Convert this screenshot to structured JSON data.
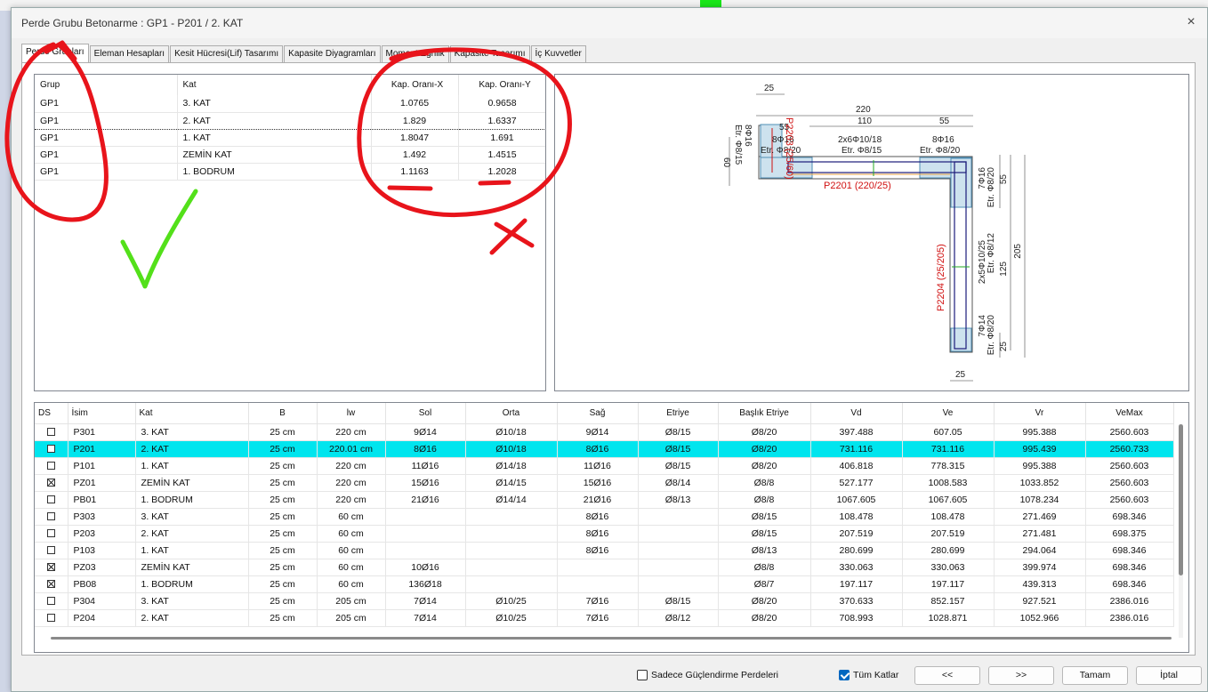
{
  "window": {
    "title": "Perde Grubu Betonarme : GP1 - P201 / 2. KAT",
    "close_icon": "×"
  },
  "tabs": [
    {
      "label": "Perde Grupları",
      "active": true
    },
    {
      "label": "Eleman Hesapları"
    },
    {
      "label": "Kesit Hücresi(Lif) Tasarımı"
    },
    {
      "label": "Kapasite Diyagramları"
    },
    {
      "label": "Moment Eğrilik"
    },
    {
      "label": "Kapasite Tasarımı"
    },
    {
      "label": "İç Kuvvetler"
    }
  ],
  "group_table": {
    "columns": [
      "Grup",
      "Kat",
      "Kap. Oranı-X",
      "Kap. Oranı-Y"
    ],
    "rows": [
      [
        "GP1",
        "3. KAT",
        "1.0765",
        "0.9658"
      ],
      [
        "GP1",
        "2. KAT",
        "1.829",
        "1.6337"
      ],
      [
        "GP1",
        "1. KAT",
        "1.8047",
        "1.691"
      ],
      [
        "GP1",
        "ZEMİN KAT",
        "1.492",
        "1.4515"
      ],
      [
        "GP1",
        "1. BODRUM",
        "1.1163",
        "1.2028"
      ]
    ],
    "selected_row": 1
  },
  "section_drawing": {
    "dims": {
      "top_25": "25",
      "total_220": "220",
      "mid_110": "110",
      "right_55": "55",
      "left_55": "55",
      "left_60": "60",
      "right_v_55": "55",
      "right_v_125": "125",
      "right_v_205": "205",
      "right_v_25": "25",
      "bottom_25": "25"
    },
    "labels": {
      "p2203": "P2203 (25/60)",
      "left_reb": "8Φ16",
      "left_etr": "Etr. Φ8/15",
      "c1_reb": "8Φ16",
      "c1_etr": "Etr. Φ8/20",
      "web_reb": "2x6Φ10/18",
      "web_etr": "Etr. Φ8/15",
      "c2_reb": "8Φ16",
      "c2_etr": "Etr. Φ8/20",
      "p2201": "P2201 (220/25)",
      "c3_reb": "7Φ16",
      "c3_etr": "Etr. Φ8/20",
      "web2_reb": "2x5Φ10/25",
      "web2_etr": "Etr. Φ8/12",
      "p2204": "P2204 (25/205)",
      "c4_reb": "7Φ14",
      "c4_etr": "Etr. Φ8/20"
    }
  },
  "element_table": {
    "columns": [
      "DS",
      "İsim",
      "Kat",
      "B",
      "lw",
      "Sol",
      "Orta",
      "Sağ",
      "Etriye",
      "Başlık Etriye",
      "Vd",
      "Ve",
      "Vr",
      "VeMax"
    ],
    "rows": [
      {
        "ds": false,
        "cells": [
          "P301",
          "3. KAT",
          "25 cm",
          "220 cm",
          "9Ø14",
          "Ø10/18",
          "9Ø14",
          "Ø8/15",
          "Ø8/20",
          "397.488",
          "607.05",
          "995.388",
          "2560.603"
        ]
      },
      {
        "ds": false,
        "cells": [
          "P201",
          "2. KAT",
          "25 cm",
          "220.01 cm",
          "8Ø16",
          "Ø10/18",
          "8Ø16",
          "Ø8/15",
          "Ø8/20",
          "731.116",
          "731.116",
          "995.439",
          "2560.733"
        ],
        "highlight": true
      },
      {
        "ds": false,
        "cells": [
          "P101",
          "1. KAT",
          "25 cm",
          "220 cm",
          "11Ø16",
          "Ø14/18",
          "11Ø16",
          "Ø8/15",
          "Ø8/20",
          "406.818",
          "778.315",
          "995.388",
          "2560.603"
        ]
      },
      {
        "ds": true,
        "cells": [
          "PZ01",
          "ZEMİN KAT",
          "25 cm",
          "220 cm",
          "15Ø16",
          "Ø14/15",
          "15Ø16",
          "Ø8/14",
          "Ø8/8",
          "527.177",
          "1008.583",
          "1033.852",
          "2560.603"
        ]
      },
      {
        "ds": false,
        "cells": [
          "PB01",
          "1. BODRUM",
          "25 cm",
          "220 cm",
          "21Ø16",
          "Ø14/14",
          "21Ø16",
          "Ø8/13",
          "Ø8/8",
          "1067.605",
          "1067.605",
          "1078.234",
          "2560.603"
        ]
      },
      {
        "ds": false,
        "cells": [
          "P303",
          "3. KAT",
          "25 cm",
          "60 cm",
          "",
          "",
          "8Ø16",
          "",
          "Ø8/15",
          "108.478",
          "108.478",
          "271.469",
          "698.346"
        ]
      },
      {
        "ds": false,
        "cells": [
          "P203",
          "2. KAT",
          "25 cm",
          "60 cm",
          "",
          "",
          "8Ø16",
          "",
          "Ø8/15",
          "207.519",
          "207.519",
          "271.481",
          "698.375"
        ]
      },
      {
        "ds": false,
        "cells": [
          "P103",
          "1. KAT",
          "25 cm",
          "60 cm",
          "",
          "",
          "8Ø16",
          "",
          "Ø8/13",
          "280.699",
          "280.699",
          "294.064",
          "698.346"
        ]
      },
      {
        "ds": true,
        "cells": [
          "PZ03",
          "ZEMİN KAT",
          "25 cm",
          "60 cm",
          "10Ø16",
          "",
          "",
          "",
          "Ø8/8",
          "330.063",
          "330.063",
          "399.974",
          "698.346"
        ]
      },
      {
        "ds": true,
        "cells": [
          "PB08",
          "1. BODRUM",
          "25 cm",
          "60 cm",
          "136Ø18",
          "",
          "",
          "",
          "Ø8/7",
          "197.117",
          "197.117",
          "439.313",
          "698.346"
        ]
      },
      {
        "ds": false,
        "cells": [
          "P304",
          "3. KAT",
          "25 cm",
          "205 cm",
          "7Ø14",
          "Ø10/25",
          "7Ø16",
          "Ø8/15",
          "Ø8/20",
          "370.633",
          "852.157",
          "927.521",
          "2386.016"
        ]
      },
      {
        "ds": false,
        "cells": [
          "P204",
          "2. KAT",
          "25 cm",
          "205 cm",
          "7Ø14",
          "Ø10/25",
          "7Ø16",
          "Ø8/12",
          "Ø8/20",
          "708.993",
          "1028.871",
          "1052.966",
          "2386.016"
        ]
      }
    ]
  },
  "footer": {
    "only_strengthening": {
      "label": "Sadece Güçlendirme Perdeleri",
      "checked": false
    },
    "all_floors": {
      "label": "Tüm Katlar",
      "checked": true
    },
    "prev_label": "<<",
    "next_label": ">>",
    "ok_label": "Tamam",
    "cancel_label": "İptal"
  },
  "colors": {
    "highlight_row": "#00e5ee",
    "annotation_red": "#e8141b",
    "annotation_green": "#53e01a",
    "section_label_red": "#d01010"
  }
}
